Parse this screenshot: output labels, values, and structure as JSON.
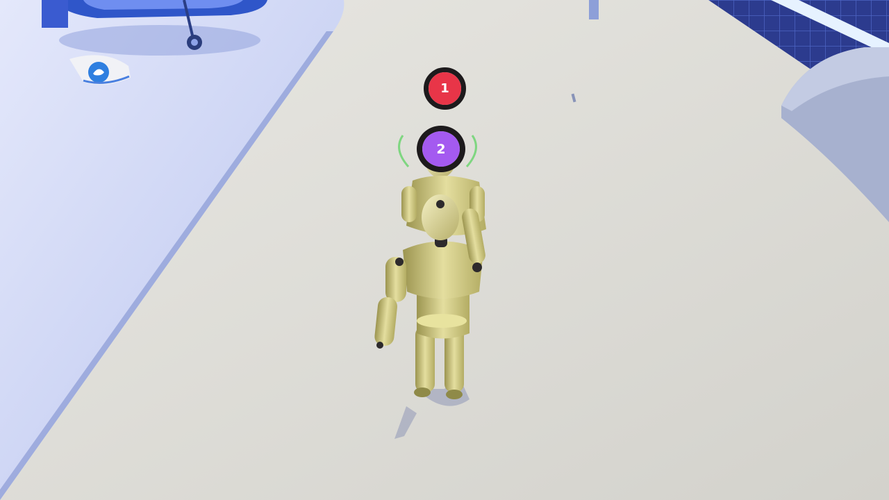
{
  "players": [
    {
      "number": "1",
      "color": "#e83548"
    },
    {
      "number": "2",
      "color": "#a45af0"
    }
  ],
  "colors": {
    "floor": "#d9d8d3",
    "platform": "#c7d1f7",
    "grid_floor": "#2c3b8e",
    "figure": "#c8c27a"
  },
  "icons": [
    "seal-emblem-icon",
    "drone-propeller-icon"
  ]
}
